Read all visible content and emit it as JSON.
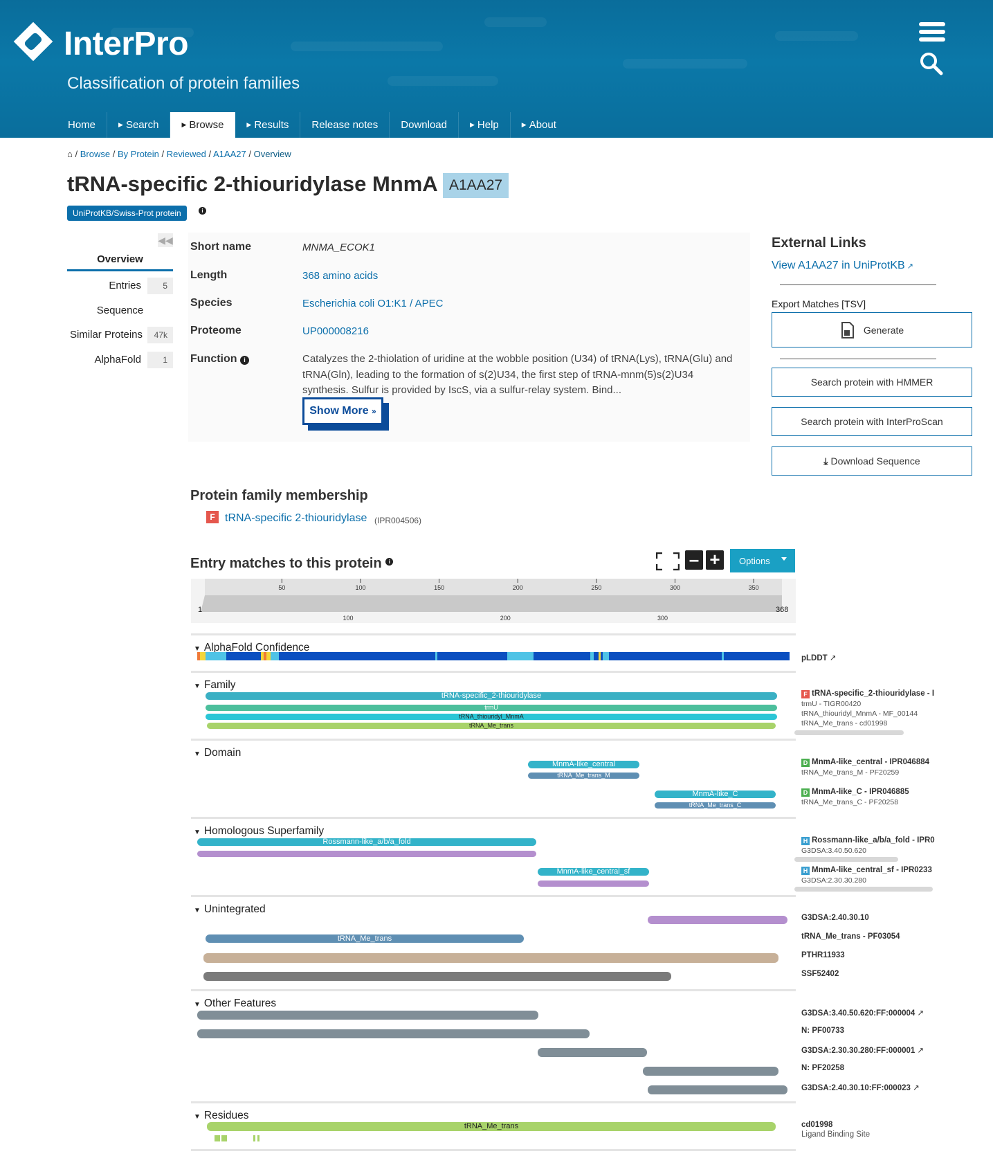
{
  "header": {
    "brand": "InterPro",
    "tagline": "Classification of protein families",
    "nav": [
      {
        "label": "Home",
        "arrow": false,
        "active": false
      },
      {
        "label": "Search",
        "arrow": true,
        "active": false
      },
      {
        "label": "Browse",
        "arrow": true,
        "active": true
      },
      {
        "label": "Results",
        "arrow": true,
        "active": false
      },
      {
        "label": "Release notes",
        "arrow": false,
        "active": false
      },
      {
        "label": "Download",
        "arrow": false,
        "active": false
      },
      {
        "label": "Help",
        "arrow": true,
        "active": false
      },
      {
        "label": "About",
        "arrow": true,
        "active": false
      }
    ]
  },
  "breadcrumb": {
    "browse": "Browse",
    "by_protein": "By Protein",
    "reviewed": "Reviewed",
    "accession": "A1AA27",
    "current": "Overview"
  },
  "page": {
    "title": "tRNA-specific 2-thiouridylase MnmA",
    "accession": "A1AA27",
    "badge": "UniProtKB/Swiss-Prot protein"
  },
  "left_menu": {
    "overview": "Overview",
    "items": [
      {
        "label": "Entries",
        "count": "5"
      },
      {
        "label": "Sequence",
        "count": ""
      },
      {
        "label": "Similar Proteins",
        "count": "47k"
      },
      {
        "label": "AlphaFold",
        "count": "1"
      }
    ]
  },
  "overview": {
    "short_name_label": "Short name",
    "short_name": "MNMA_ECOK1",
    "length_label": "Length",
    "length": "368 amino acids",
    "species_label": "Species",
    "species": "Escherichia coli O1:K1 / APEC",
    "proteome_label": "Proteome",
    "proteome": "UP000008216",
    "function_label": "Function",
    "function_text": "Catalyzes the 2-thiolation of uridine at the wobble position (U34) of tRNA(Lys), tRNA(Glu) and tRNA(Gln), leading to the formation of s(2)U34, the first step of tRNA-mnm(5)s(2)U34 synthesis. Sulfur is provided by IscS, via a sulfur-relay system. Bind...",
    "show_more": "Show More"
  },
  "external": {
    "title": "External Links",
    "uniprot_link": "View A1AA27 in UniProtKB",
    "export_label": "Export Matches [TSV]",
    "generate": "Generate",
    "hmmer": "Search protein with HMMER",
    "interproscan": "Search protein with InterProScan",
    "download": "Download Sequence"
  },
  "membership": {
    "title": "Protein family membership",
    "type_letter": "F",
    "name": "tRNA-specific 2-thiouridylase",
    "accession": "(IPR004506)"
  },
  "matches": {
    "title": "Entry matches to this protein",
    "options": "Options",
    "length": 368,
    "ruler_top": [
      "50",
      "100",
      "150",
      "200",
      "250",
      "300",
      "350"
    ],
    "ruler_bottom": [
      "100",
      "200",
      "300"
    ],
    "start_label": "1",
    "end_label": "368",
    "sections": {
      "alphafold": "AlphaFold Confidence",
      "family": "Family",
      "domain": "Domain",
      "homologous": "Homologous Superfamily",
      "unintegrated": "Unintegrated",
      "other": "Other Features",
      "residues": "Residues"
    },
    "colors": {
      "family_main": "#3ab0c4",
      "trmu": "#4cbf9c",
      "thiouridyl": "#2bc6d6",
      "me_trans_green": "#a8d36a",
      "domain_cyan": "#33b3c9",
      "domain_blue": "#5f8fb3",
      "purple": "#b48fce",
      "tan": "#c7b098",
      "dark_grey": "#7b7b7b",
      "slate": "#808e97",
      "plddt_dark": "#0b4fc0",
      "plddt_light": "#4fc3e6"
    },
    "bars": {
      "family_main": "tRNA-specific_2-thiouridylase",
      "trmu": "trmU",
      "thiouridyl": "tRNA_thiouridyl_MnmA",
      "me_trans": "tRNA_Me_trans",
      "central": "MnmA-like_central",
      "trans_m": "tRNA_Me_trans_M",
      "like_c": "MnmA-like_C",
      "trans_c": "tRNA_Me_trans_C",
      "rossmann": "Rossmann-like_a/b/a_fold",
      "central_sf": "MnmA-like_central_sf",
      "unint_me_trans": "tRNA_Me_trans",
      "res_me_trans": "tRNA_Me_trans"
    },
    "labels": {
      "plddt": "pLDDT",
      "fam_title": "tRNA-specific_2-thiouridylase - I",
      "fam_sub1": "trmU - TIGR00420",
      "fam_sub2": "tRNA_thiouridyl_MnmA - MF_00144",
      "fam_sub3": "tRNA_Me_trans - cd01998",
      "dom1_title": "MnmA-like_central - IPR046884",
      "dom1_sub": "tRNA_Me_trans_M - PF20259",
      "dom2_title": "MnmA-like_C - IPR046885",
      "dom2_sub": "tRNA_Me_trans_C - PF20258",
      "hs1_title": "Rossmann-like_a/b/a_fold - IPR0",
      "hs1_sub": "G3DSA:3.40.50.620",
      "hs2_title": "MnmA-like_central_sf - IPR0233",
      "hs2_sub": "G3DSA:2.30.30.280",
      "un1": "G3DSA:2.40.30.10",
      "un2": "tRNA_Me_trans - PF03054",
      "un3": "PTHR11933",
      "un4": "SSF52402",
      "of1": "G3DSA:3.40.50.620:FF:000004",
      "of2": "N: PF00733",
      "of3": "G3DSA:2.30.30.280:FF:000001",
      "of4": "N: PF20258",
      "of5": "G3DSA:2.40.30.10:FF:000023",
      "res_title": "cd01998",
      "res_sub": "Ligand Binding Site"
    },
    "type_letters": {
      "family": "F",
      "domain": "D",
      "homologous": "H"
    }
  }
}
